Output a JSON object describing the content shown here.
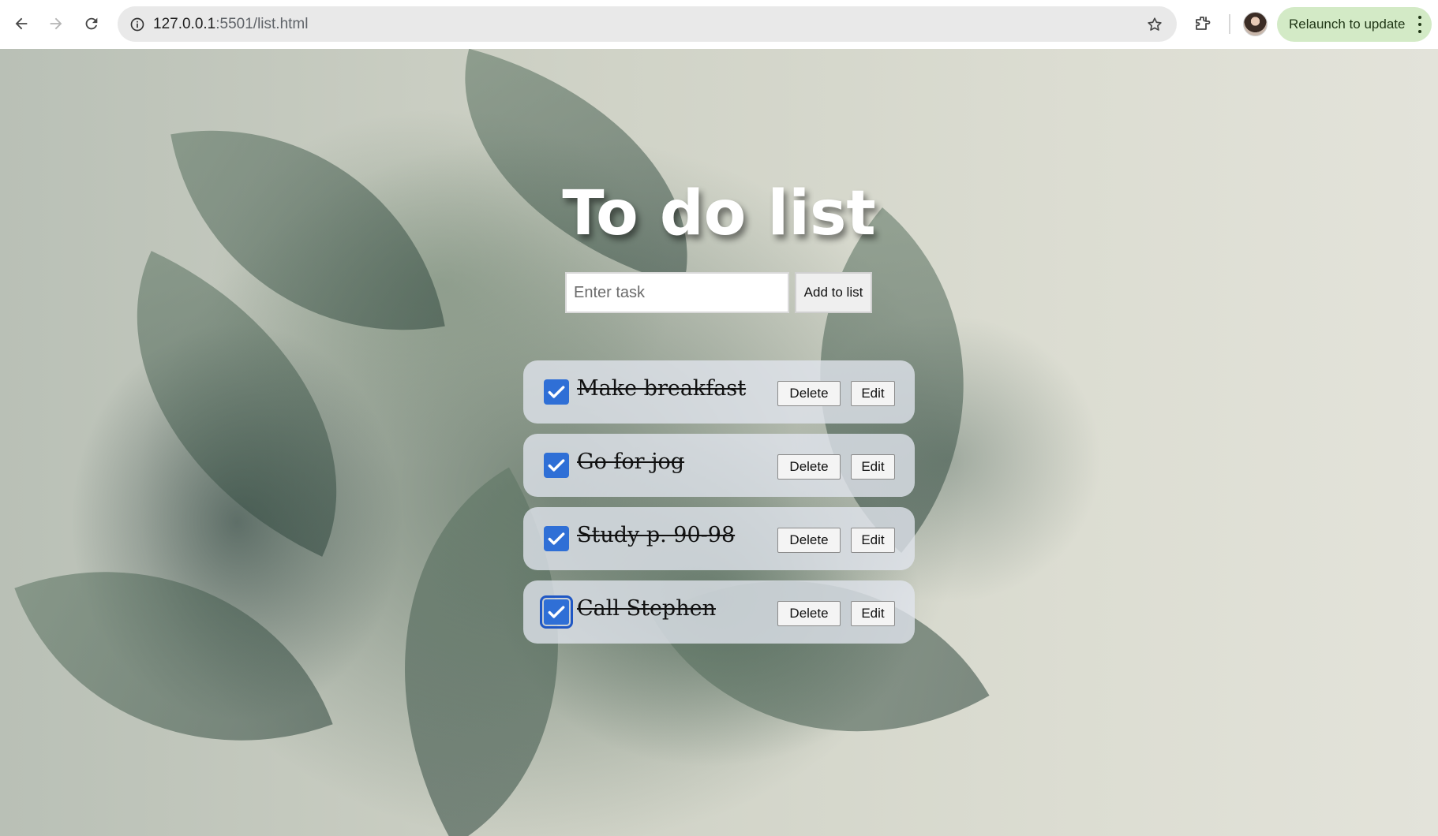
{
  "browser": {
    "url_host": "127.0.0.1",
    "url_path": ":5501/list.html",
    "relaunch_label": "Relaunch to update"
  },
  "page": {
    "title": "To do list",
    "input_placeholder": "Enter task",
    "input_value": "",
    "add_button_label": "Add to list"
  },
  "todos": [
    {
      "text": "Make breakfast",
      "done": true,
      "delete_label": "Delete",
      "edit_label": "Edit"
    },
    {
      "text": "Go for jog",
      "done": true,
      "delete_label": "Delete",
      "edit_label": "Edit"
    },
    {
      "text": "Study p. 90-98",
      "done": true,
      "delete_label": "Delete",
      "edit_label": "Edit"
    },
    {
      "text": "Call Stephen",
      "done": true,
      "delete_label": "Delete",
      "edit_label": "Edit"
    }
  ],
  "colors": {
    "checkbox_accent": "#2f6fd6",
    "item_background": "#e2e6ee",
    "relaunch_button": "#d3eac6"
  },
  "icons": [
    "back-arrow-icon",
    "forward-arrow-icon",
    "reload-icon",
    "site-info-icon",
    "star-icon",
    "extensions-icon",
    "more-vert-icon",
    "check-icon"
  ]
}
